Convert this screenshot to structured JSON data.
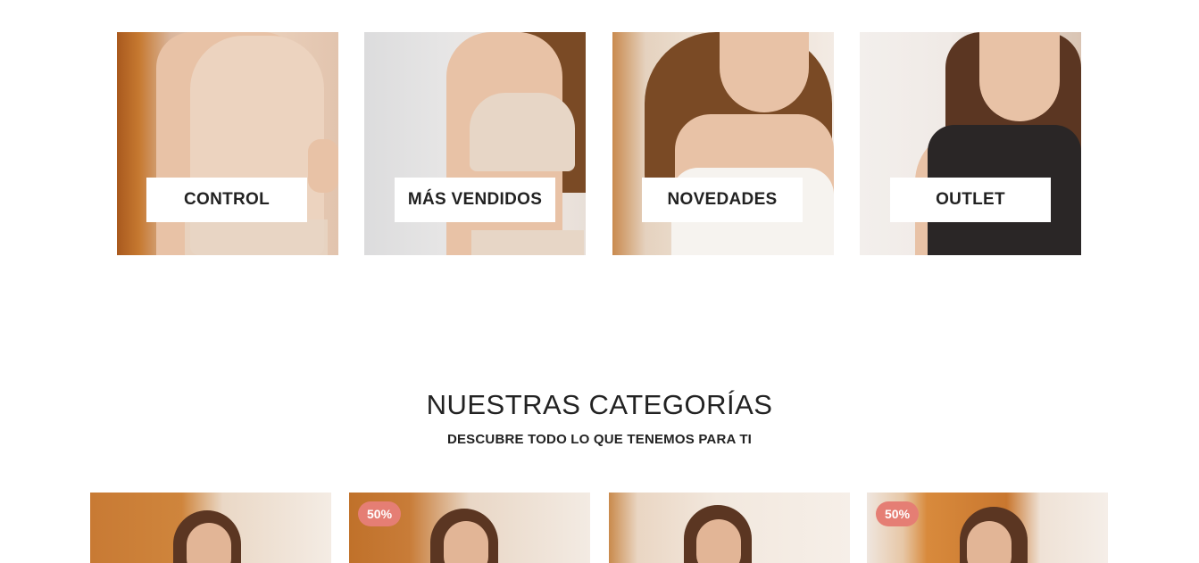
{
  "promo_tiles": [
    {
      "label": "CONTROL"
    },
    {
      "label": "MÁS VENDIDOS"
    },
    {
      "label": "NOVEDADES"
    },
    {
      "label": "OUTLET"
    }
  ],
  "categories_section": {
    "title": "NUESTRAS CATEGORÍAS",
    "subtitle": "DESCUBRE TODO LO QUE TENEMOS PARA TI"
  },
  "category_cards": [
    {
      "badge": ""
    },
    {
      "badge": "50%"
    },
    {
      "badge": ""
    },
    {
      "badge": "50%"
    }
  ],
  "colors": {
    "badge": "#e57e74",
    "text": "#222222",
    "label_bg": "#ffffff"
  }
}
